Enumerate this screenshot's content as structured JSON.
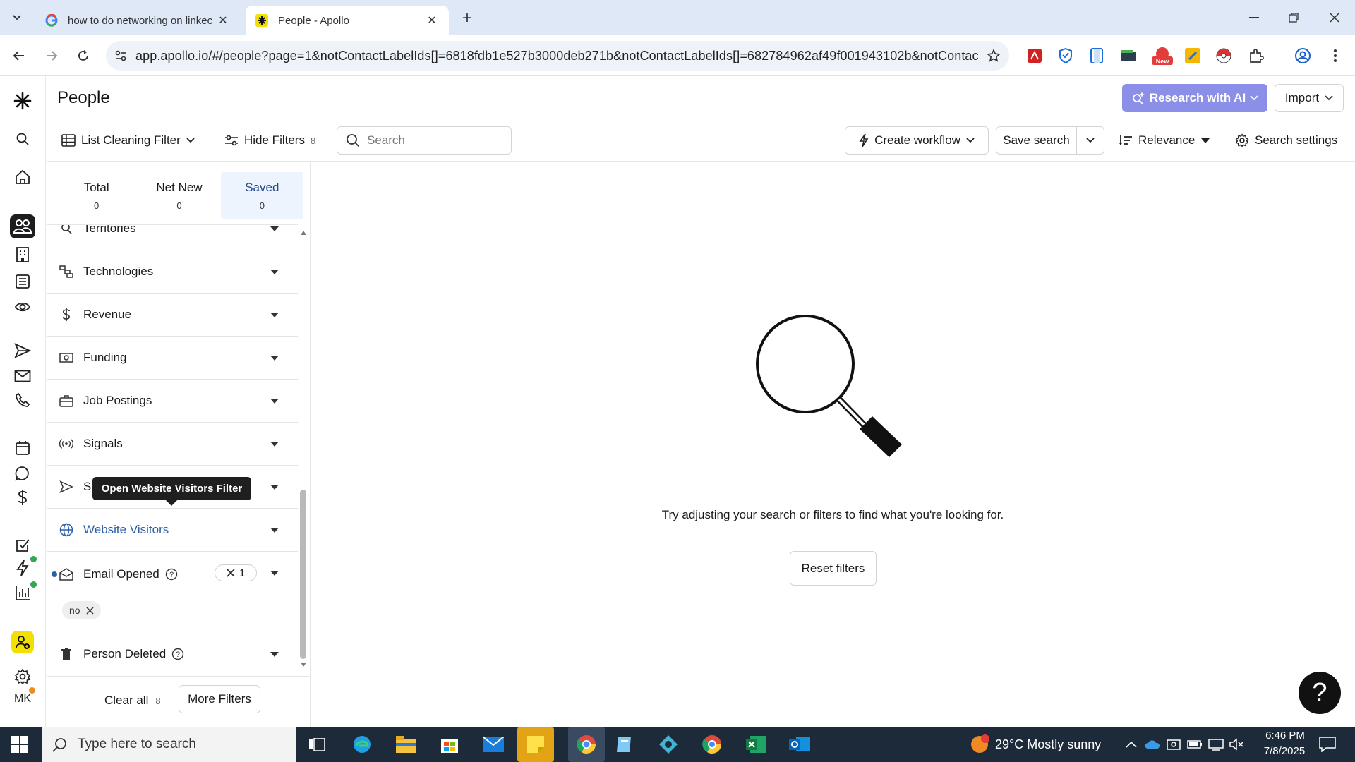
{
  "browser": {
    "tabs": [
      {
        "title": "how to do networking on linkec",
        "active": false
      },
      {
        "title": "People - Apollo",
        "active": true
      }
    ],
    "url": "app.apollo.io/#/people?page=1&notContactLabelIds[]=6818fdb1e527b3000deb271b&notContactLabelIds[]=682784962af49f001943102b&notContact..."
  },
  "header": {
    "title": "People",
    "research_ai": "Research with AI",
    "import": "Import"
  },
  "filterbar": {
    "list_filter": "List Cleaning Filter",
    "hide_filters": "Hide Filters",
    "hide_filters_count": "8",
    "search_placeholder": "Search",
    "create_workflow": "Create workflow",
    "save_search": "Save search",
    "relevance": "Relevance",
    "search_settings": "Search settings"
  },
  "counts": [
    {
      "label": "Total",
      "value": "0"
    },
    {
      "label": "Net New",
      "value": "0"
    },
    {
      "label": "Saved",
      "value": "0"
    }
  ],
  "filters": {
    "territories": "Territories",
    "technologies": "Technologies",
    "revenue": "Revenue",
    "funding": "Funding",
    "job_postings": "Job Postings",
    "signals": "Signals",
    "sequences_partial": "S",
    "website_visitors": "Website Visitors",
    "email_opened": "Email Opened",
    "email_opened_count": "1",
    "email_opened_tag": "no",
    "person_deleted": "Person Deleted"
  },
  "tooltip": "Open Website Visitors Filter",
  "footer": {
    "clear_all": "Clear all",
    "clear_all_count": "8",
    "more_filters": "More Filters"
  },
  "empty_state": {
    "message": "Try adjusting your search or filters to find what you're looking for.",
    "reset": "Reset filters"
  },
  "help": "?",
  "rail": {
    "avatar_initials": "MK"
  },
  "taskbar": {
    "search_placeholder": "Type here to search",
    "weather": "29°C  Mostly sunny",
    "time": "6:46 PM",
    "date": "7/8/2025"
  },
  "colors": {
    "accent_ai": "#8b8fe8",
    "link_blue": "#2b5fa8",
    "apollo_yellow": "#f2e100"
  }
}
